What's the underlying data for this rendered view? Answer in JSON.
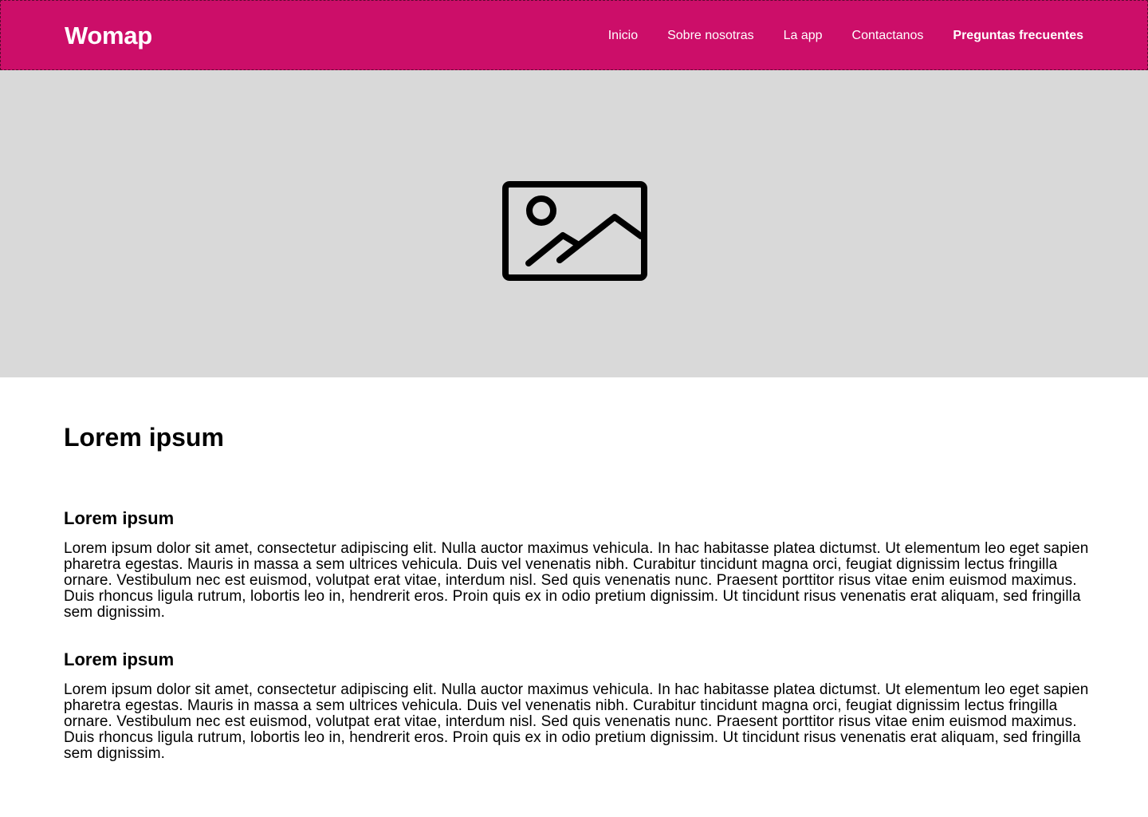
{
  "header": {
    "logo": "Womap",
    "nav": [
      "Inicio",
      "Sobre nosotras",
      "La app",
      "Contactanos",
      "Preguntas frecuentes"
    ],
    "active_nav": "Preguntas frecuentes"
  },
  "hero": {
    "icon": "image-placeholder-icon"
  },
  "main": {
    "title": "Lorem ipsum",
    "sections": [
      {
        "heading": "Lorem ipsum",
        "body": "Lorem ipsum dolor sit amet, consectetur adipiscing elit. Nulla auctor maximus vehicula. In hac habitasse platea dictumst. Ut elementum leo eget sapien pharetra egestas. Mauris in massa a sem ultrices vehicula. Duis vel venenatis nibh. Curabitur tincidunt magna orci, feugiat dignissim lectus fringilla ornare. Vestibulum nec est euismod, volutpat erat vitae, interdum nisl. Sed quis venenatis nunc. Praesent porttitor risus vitae enim euismod maximus. Duis rhoncus ligula rutrum, lobortis leo in, hendrerit eros. Proin quis ex in odio pretium dignissim. Ut tincidunt risus venenatis erat aliquam, sed fringilla sem dignissim."
      },
      {
        "heading": "Lorem ipsum",
        "body": "Lorem ipsum dolor sit amet, consectetur adipiscing elit. Nulla auctor maximus vehicula. In hac habitasse platea dictumst. Ut elementum leo eget sapien pharetra egestas. Mauris in massa a sem ultrices vehicula. Duis vel venenatis nibh. Curabitur tincidunt magna orci, feugiat dignissim lectus fringilla ornare. Vestibulum nec est euismod, volutpat erat vitae, interdum nisl. Sed quis venenatis nunc. Praesent porttitor risus vitae enim euismod maximus. Duis rhoncus ligula rutrum, lobortis leo in, hendrerit eros. Proin quis ex in odio pretium dignissim. Ut tincidunt risus venenatis erat aliquam, sed fringilla sem dignissim."
      }
    ]
  },
  "colors": {
    "brand": "#cc0e69",
    "hero_bg": "#d9d9d9",
    "text": "#000000"
  }
}
